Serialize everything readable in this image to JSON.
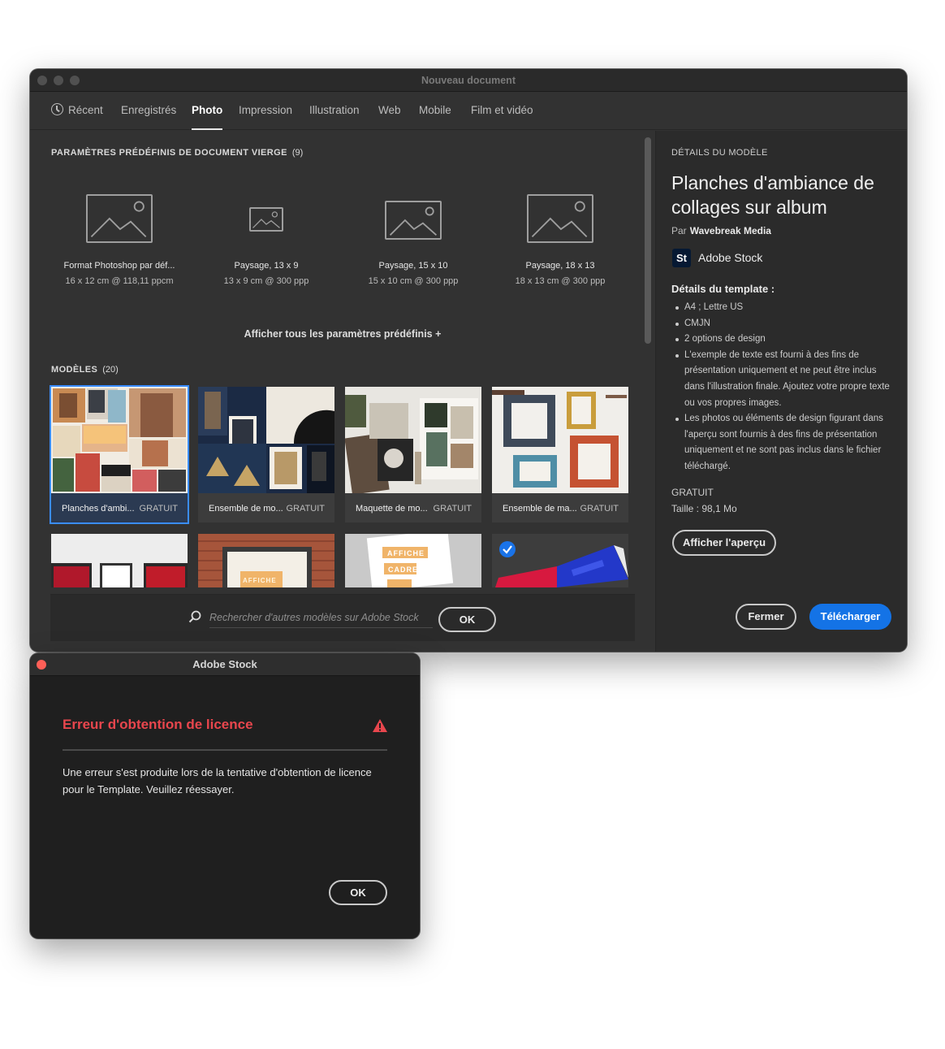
{
  "window": {
    "title": "Nouveau document",
    "tabs": [
      {
        "label": "Récent",
        "icon": "clock-icon"
      },
      {
        "label": "Enregistrés"
      },
      {
        "label": "Photo"
      },
      {
        "label": "Impression"
      },
      {
        "label": "Illustration"
      },
      {
        "label": "Web"
      },
      {
        "label": "Mobile"
      },
      {
        "label": "Film et vidéo"
      }
    ],
    "active_tab": "Photo"
  },
  "presets": {
    "section_label": "PARAMÈTRES PRÉDÉFINIS DE DOCUMENT VIERGE",
    "count": "(9)",
    "items": [
      {
        "name": "Format Photoshop par déf...",
        "size": "16 x 12 cm @ 118,11 ppcm"
      },
      {
        "name": "Paysage, 13 x 9",
        "size": "13 x 9 cm @ 300 ppp"
      },
      {
        "name": "Paysage, 15 x 10",
        "size": "15 x 10 cm @ 300 ppp"
      },
      {
        "name": "Paysage, 18 x 13",
        "size": "18 x 13 cm @ 300 ppp"
      }
    ],
    "show_all": "Afficher tous les paramètres prédéfinis +"
  },
  "templates": {
    "section_label": "MODÈLES",
    "count": "(20)",
    "items": [
      {
        "name": "Planches d'ambi...",
        "price": "GRATUIT"
      },
      {
        "name": "Ensemble de mo...",
        "price": "GRATUIT"
      },
      {
        "name": "Maquette de mo...",
        "price": "GRATUIT"
      },
      {
        "name": "Ensemble de ma...",
        "price": "GRATUIT"
      }
    ],
    "row2_labels": {
      "affiche": "AFFICHE",
      "affiche2": "AFFICHE",
      "cadre": "CADRE"
    }
  },
  "search": {
    "placeholder": "Rechercher d'autres modèles sur Adobe Stock",
    "ok_label": "OK"
  },
  "details": {
    "section_label": "DÉTAILS DU MODÈLE",
    "title": "Planches d'ambiance de collages sur album",
    "by_label": "Par",
    "author": "Wavebreak Media",
    "stock_badge": "St",
    "stock_name": "Adobe Stock",
    "template_details_label": "Détails du template :",
    "bullets": [
      "A4 ; Lettre US",
      "CMJN",
      "2 options de design",
      "L'exemple de texte est fourni à des fins de présentation uniquement et ne peut être inclus dans l'illustration finale. Ajoutez votre propre texte ou vos propres images.",
      "Les photos ou éléments de design figurant dans l'aperçu sont fournis à des fins de présentation uniquement et ne sont pas inclus dans le fichier téléchargé."
    ],
    "price": "GRATUIT",
    "size_label": "Taille :",
    "size_value": "98,1 Mo",
    "preview_button": "Afficher l'aperçu",
    "close_button": "Fermer",
    "download_button": "Télécharger"
  },
  "dialog": {
    "title": "Adobe Stock",
    "error_title": "Erreur d'obtention de licence",
    "message": "Une erreur s'est produite lors de la tentative d'obtention de licence pour le Template. Veuillez réessayer.",
    "ok_label": "OK"
  },
  "colors": {
    "accent": "#1473e6",
    "selection": "#3a8dff",
    "error": "#e8464d",
    "close_dot": "#ff5f57"
  }
}
